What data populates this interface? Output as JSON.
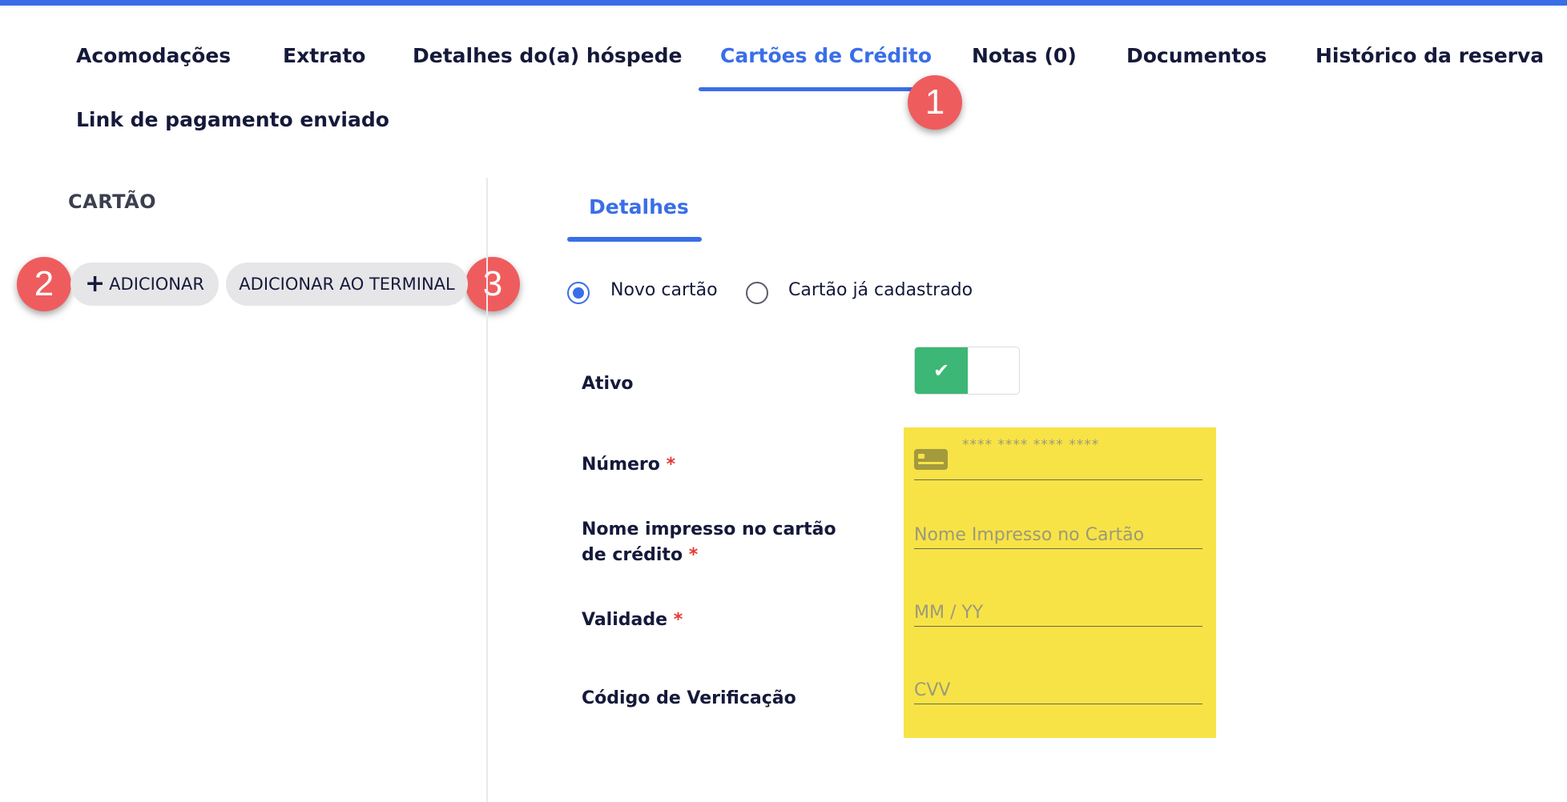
{
  "tabs": [
    {
      "label": "Acomodações"
    },
    {
      "label": "Extrato"
    },
    {
      "label": "Detalhes do(a) hóspede"
    },
    {
      "label": "Cartões de Crédito",
      "active": true
    },
    {
      "label": "Notas (0)"
    },
    {
      "label": "Documentos"
    },
    {
      "label": "Histórico da reserva"
    },
    {
      "label": "Link de pagamento enviado"
    }
  ],
  "annotations": [
    "1",
    "2",
    "3"
  ],
  "card_section": {
    "title": "CARTÃO",
    "add_button": "ADICIONAR",
    "add_button_icon": "plus-icon",
    "add_terminal_button": "ADICIONAR AO TERMINAL"
  },
  "details": {
    "subtab": "Detalhes",
    "radio_new": "Novo cartão",
    "radio_existing": "Cartão já cadastrado",
    "radio_selected": "new",
    "active_label": "Ativo",
    "active_on": true,
    "number_label": "Número",
    "number_placeholder": "**** **** **** ****",
    "name_label": "Nome impresso no cartão de crédito",
    "name_placeholder": "Nome Impresso no Cartão",
    "expiry_label": "Validade",
    "expiry_placeholder": "MM / YY",
    "cvv_label": "Código de Verificação",
    "cvv_placeholder": "CVV",
    "required_mark": "*"
  },
  "colors": {
    "accent": "#3a6ee8",
    "badge": "#ef5c5e",
    "toggle_on": "#3cb775",
    "highlight": "#f8e346",
    "required": "#e53935"
  }
}
